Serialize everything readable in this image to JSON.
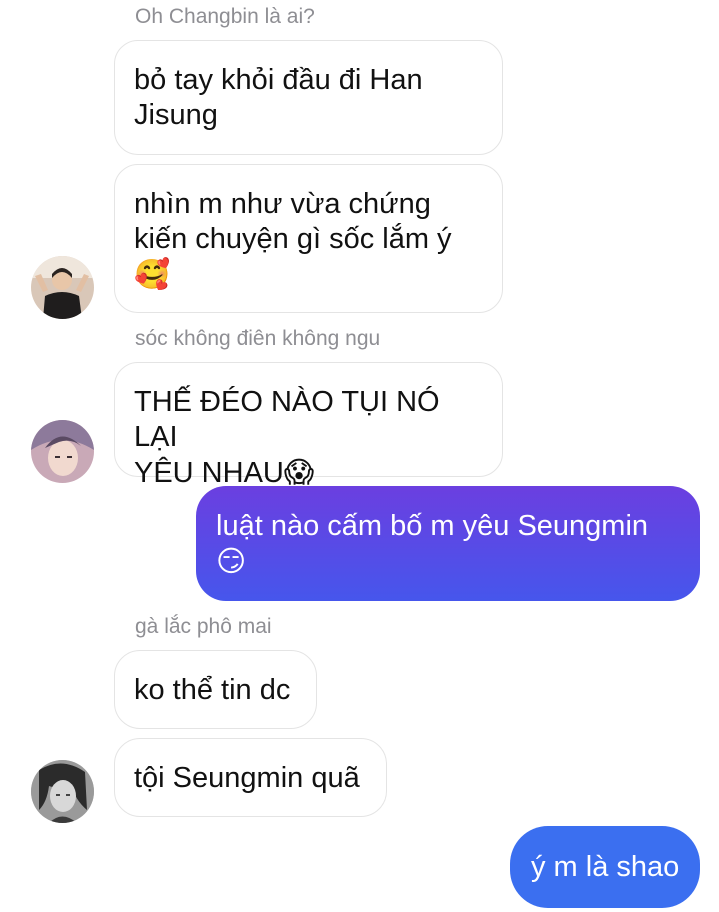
{
  "chat": {
    "sender_1": "Oh Changbin là ai?",
    "msg_1": "bỏ tay khỏi đầu đi Han Jisung",
    "msg_1_line1": "bỏ tay khỏi đầu đi Han",
    "msg_1_line2": "Jisung",
    "msg_2_line1": "nhìn m như vừa chứng",
    "msg_2_line2": "kiến chuyện gì sốc lắm ý",
    "msg_2_emoji": "🥰",
    "sender_2": "sóc không điên không ngu",
    "msg_3_line1": "THẾ ĐÉO NÀO TỤI NÓ LẠI",
    "msg_3_line2": "YÊU NHAU",
    "msg_3_emoji": "😱",
    "out_1_line1": "luật nào cấm bố m yêu Seungmin",
    "out_1_emoji": "😏",
    "sender_3": "gà lắc phô mai",
    "msg_4": "ko thể tin dc",
    "msg_5": "tội Seungmin quã",
    "out_2": "ý m là shao"
  },
  "colors": {
    "outgoing_gradient_start": "#6b3fe0",
    "outgoing_gradient_end": "#4656ec",
    "outgoing_blue": "#3b6ff0",
    "incoming_border": "#e4e4e4",
    "sender_gray": "#8e8e93"
  }
}
